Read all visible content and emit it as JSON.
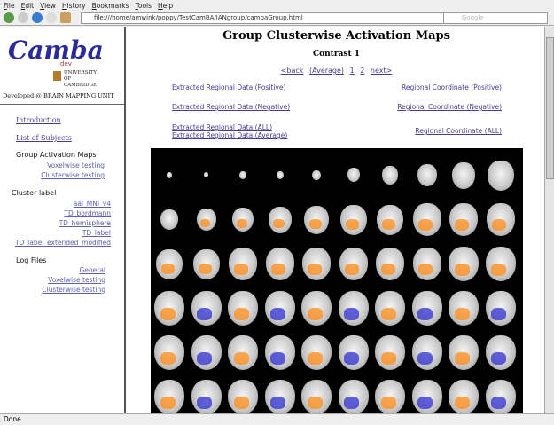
{
  "browser": {
    "menu": [
      "File",
      "Edit",
      "View",
      "History",
      "Bookmarks",
      "Tools",
      "Help"
    ],
    "url": "file:///home/amwink/poppy/TestCamBA/IANgroup/cambaGroup.html",
    "search_placeholder": "Google",
    "status": "Done"
  },
  "sidebar": {
    "logo": "Camba",
    "logo_sub": "dev",
    "university": "UNIVERSITY OF CAMBRIDGE",
    "developed": "Developed @ BRAIN MAPPING UNIT",
    "introduction": "Introduction",
    "subjects": "List of Subjects",
    "group_heading": "Group Activation Maps",
    "group_items": [
      "Voxelwise testing",
      "Clusterwise testing"
    ],
    "cluster_heading": "Cluster label",
    "cluster_items": [
      "aal_MNI_v4",
      "TD_bordmann",
      "TD_hemisphere",
      "TD_label",
      "TD_label_extended_modified"
    ],
    "log_heading": "Log Files",
    "log_items": [
      "General",
      "Voxelwise testing",
      "Clusterwise testing"
    ]
  },
  "main": {
    "title": "Group Clusterwise Activation Maps",
    "contrast": "Contrast 1",
    "pager": [
      "<back",
      "(Average)",
      "1",
      "2",
      "next>"
    ],
    "links_left": [
      "Extracted Regional Data (Positive)",
      "Extracted Regional Data (Negative)",
      "Extracted Regional Data (ALL)",
      "Extracted Regional Data (Average)"
    ],
    "links_right": [
      "Regional Coordinate (Positive)",
      "Regional Coordinate (Negative)",
      "Regional Coordinate (ALL)"
    ],
    "colors": {
      "activation_positive": "#ff8c1a",
      "activation_negative": "#3030d0",
      "background": "#000000"
    }
  }
}
